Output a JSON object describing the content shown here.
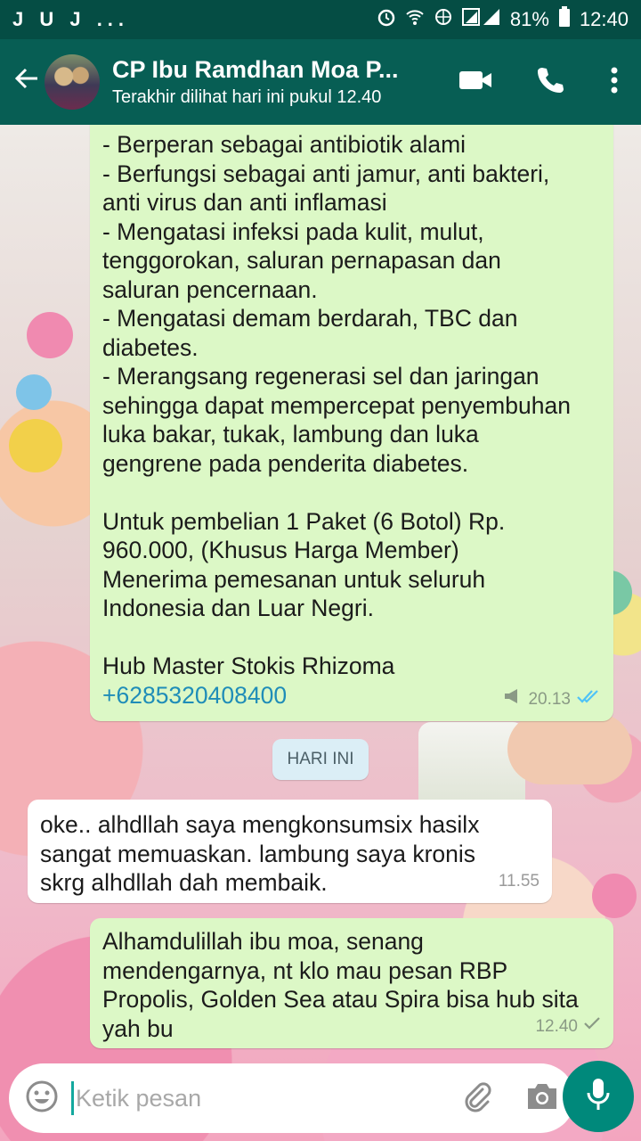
{
  "status_bar": {
    "left_text": "J U J ...",
    "battery": "81%",
    "time": "12:40"
  },
  "header": {
    "title": "CP Ibu Ramdhan Moa P...",
    "subtitle": "Terakhir dilihat hari ini pukul 12.40",
    "icons": [
      "back-arrow-icon",
      "video-call-icon",
      "phone-icon",
      "more-vert-icon"
    ]
  },
  "messages": [
    {
      "direction": "outgoing",
      "lines": [
        "- Berperan sebagai antibiotik alami",
        "- Berfungsi sebagai anti jamur, anti bakteri,",
        "anti virus dan anti inflamasi",
        "- Mengatasi infeksi pada kulit, mulut,",
        "tenggorokan, saluran pernapasan dan",
        "saluran pencernaan.",
        "- Mengatasi demam berdarah, TBC dan",
        "diabetes.",
        "- Merangsang regenerasi sel dan jaringan",
        "sehingga dapat mempercepat penyembuhan",
        "luka bakar, tukak, lambung dan luka",
        "gengrene pada penderita diabetes.",
        "",
        "Untuk pembelian 1 Paket (6 Botol) Rp.",
        "960.000, (Khusus Harga Member)",
        "Menerima pemesanan untuk seluruh",
        "Indonesia dan Luar Negri.",
        "",
        "Hub Master Stokis Rhizoma"
      ],
      "link": "+6285320408400",
      "time": "20.13",
      "status": "read"
    },
    {
      "direction": "incoming",
      "lines": [
        "oke.. alhdllah  saya  mengkonsumsix hasilx",
        "sangat memuaskan.   lambung saya kronis",
        "skrg  alhdllah  dah membaik."
      ],
      "time": "11.55"
    },
    {
      "direction": "outgoing",
      "lines": [
        "Alhamdulillah ibu moa, senang",
        "mendengarnya, nt klo mau pesan RBP",
        "Propolis, Golden Sea atau Spira bisa hub sita",
        "yah bu"
      ],
      "time": "12.40",
      "status": "sent"
    }
  ],
  "date_divider": "HARI INI",
  "composer": {
    "placeholder": "Ketik pesan"
  },
  "colors": {
    "header": "#075e54",
    "status_bar": "#054d44",
    "outgoing_bubble": "#dcf8c6",
    "incoming_bubble": "#ffffff",
    "accent": "#00897b",
    "read_tick": "#4fc3f7"
  }
}
